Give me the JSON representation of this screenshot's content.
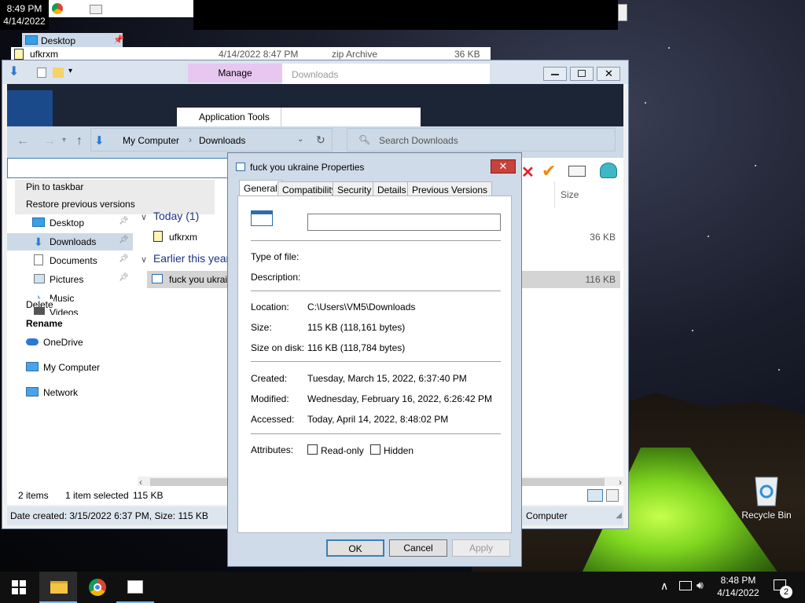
{
  "top_clock": {
    "time": "8:49 PM",
    "date": "4/14/2022"
  },
  "ghost_rows": {
    "desktop": "Desktop",
    "file": {
      "name": "ufkrxm",
      "date": "4/14/2022 8:47 PM",
      "type": "zip Archive",
      "size": "36 KB"
    }
  },
  "explorer": {
    "ribbon_tabs": {
      "manage": "Manage",
      "downloads": "Downloads",
      "application_tools": "Application Tools"
    },
    "breadcrumb": [
      "My Computer",
      "Downloads"
    ],
    "search_placeholder": "Search Downloads",
    "context_menu": [
      "Pin to taskbar",
      "Restore previous versions"
    ],
    "context_extra": [
      "Delete",
      "Rename"
    ],
    "nav": [
      {
        "label": "Desktop",
        "icon": "desktop-icon",
        "pinned": true
      },
      {
        "label": "Downloads",
        "icon": "download-arrow-icon",
        "pinned": true,
        "selected": true
      },
      {
        "label": "Documents",
        "icon": "document-icon",
        "pinned": true
      },
      {
        "label": "Pictures",
        "icon": "picture-icon",
        "pinned": true
      },
      {
        "label": "Music",
        "icon": "music-note-icon"
      },
      {
        "label": "Videos",
        "icon": "video-icon"
      },
      {
        "label": "OneDrive",
        "icon": "cloud-icon"
      },
      {
        "label": "My Computer",
        "icon": "computer-icon"
      },
      {
        "label": "Network",
        "icon": "network-icon"
      }
    ],
    "column_size": "Size",
    "groups": [
      {
        "label": "Today (1)",
        "file": "ufkrxm",
        "size": "36 KB"
      },
      {
        "label": "Earlier this year",
        "file": "fuck you ukrain",
        "size": "116 KB"
      }
    ],
    "status_left": {
      "items": "2 items",
      "selected": "1 item selected",
      "selected_size": "115 KB"
    },
    "bottom_left": "Date created: 3/15/2022 6:37 PM, Size: 115 KB",
    "bottom_right": "Computer"
  },
  "dialog": {
    "title": "fuck you ukraine Properties",
    "tabs": [
      "General",
      "Compatibility",
      "Security",
      "Details",
      "Previous Versions"
    ],
    "name_value": "",
    "fields": {
      "type_label": "Type of file:",
      "type_value": "",
      "desc_label": "Description:",
      "desc_value": "",
      "location_label": "Location:",
      "location_value": "C:\\Users\\VM5\\Downloads",
      "size_label": "Size:",
      "size_value": "115 KB (118,161 bytes)",
      "sizedisk_label": "Size on disk:",
      "sizedisk_value": "116 KB (118,784 bytes)",
      "created_label": "Created:",
      "created_value": "Tuesday, March 15, 2022, 6:37:40 PM",
      "modified_label": "Modified:",
      "modified_value": "Wednesday, February 16, 2022, 6:26:42 PM",
      "accessed_label": "Accessed:",
      "accessed_value": "Today, April 14, 2022, 8:48:02 PM",
      "attributes_label": "Attributes:",
      "readonly_label": "Read-only",
      "hidden_label": "Hidden"
    },
    "buttons": {
      "ok": "OK",
      "cancel": "Cancel",
      "apply": "Apply"
    }
  },
  "desktop_icons": {
    "recycle_bin": "Recycle Bin"
  },
  "taskbar": {
    "clock_time": "8:48 PM",
    "clock_date": "4/14/2022",
    "notifications_count": "2"
  }
}
